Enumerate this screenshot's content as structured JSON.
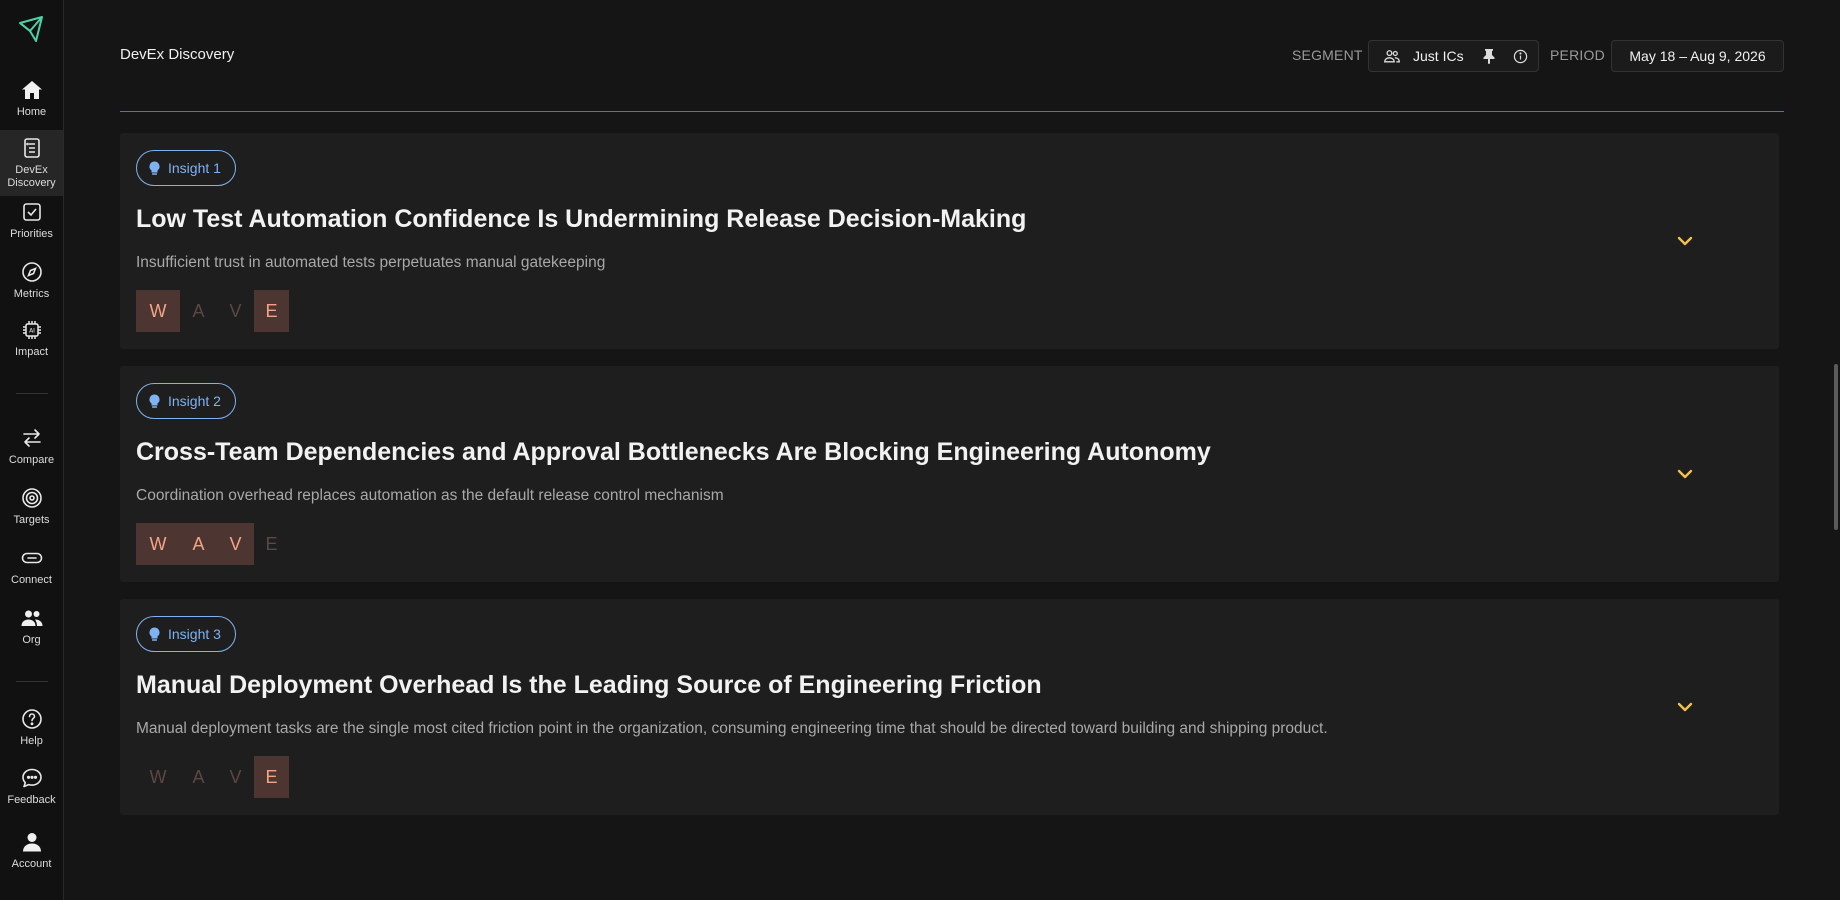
{
  "sidebar": {
    "items": [
      {
        "label": "Home",
        "icon": "home-icon"
      },
      {
        "label": "DevEx Discovery",
        "icon": "clipboard-list-icon",
        "active": true
      },
      {
        "label": "Priorities",
        "icon": "checkbox-icon"
      },
      {
        "label": "Metrics",
        "icon": "compass-icon"
      },
      {
        "label": "Impact",
        "icon": "ai-chip-icon"
      },
      {
        "label": "Compare",
        "icon": "arrows-swap-icon"
      },
      {
        "label": "Targets",
        "icon": "target-icon"
      },
      {
        "label": "Connect",
        "icon": "link-icon"
      },
      {
        "label": "Org",
        "icon": "users-icon"
      },
      {
        "label": "Help",
        "icon": "help-circle-icon"
      },
      {
        "label": "Feedback",
        "icon": "chat-bubble-icon"
      },
      {
        "label": "Account",
        "icon": "user-icon"
      }
    ]
  },
  "header": {
    "title": "DevEx Discovery",
    "segment_label": "SEGMENT",
    "segment_value": "Just ICs",
    "period_label": "PERIOD",
    "period_value": "May 18 – Aug 9, 2026"
  },
  "insights": [
    {
      "badge": "Insight 1",
      "title": "Low Test Automation Confidence Is Undermining Release Decision-Making",
      "subtitle": "Insufficient trust in automated tests perpetuates manual gatekeeping",
      "wave": {
        "W": true,
        "A": false,
        "V": false,
        "E": true
      }
    },
    {
      "badge": "Insight 2",
      "title": "Cross-Team Dependencies and Approval Bottlenecks Are Blocking Engineering Autonomy",
      "subtitle": "Coordination overhead replaces automation as the default release control mechanism",
      "wave": {
        "W": true,
        "A": true,
        "V": true,
        "E": false
      }
    },
    {
      "badge": "Insight 3",
      "title": "Manual Deployment Overhead Is the Leading Source of Engineering Friction",
      "subtitle": "Manual deployment tasks are the single most cited friction point in the organization, consuming engineering time that should be directed toward building and shipping product.",
      "wave": {
        "W": false,
        "A": false,
        "V": false,
        "E": true
      }
    }
  ],
  "wave_letters": {
    "W": "W",
    "A": "A",
    "V": "V",
    "E": "E"
  },
  "colors": {
    "accent_blue": "#7fb2f0",
    "wave_on_bg": "#4d3532",
    "wave_on_text": "#f3a487",
    "chevron": "#f2c14e",
    "logo": "#4fd1a5"
  }
}
